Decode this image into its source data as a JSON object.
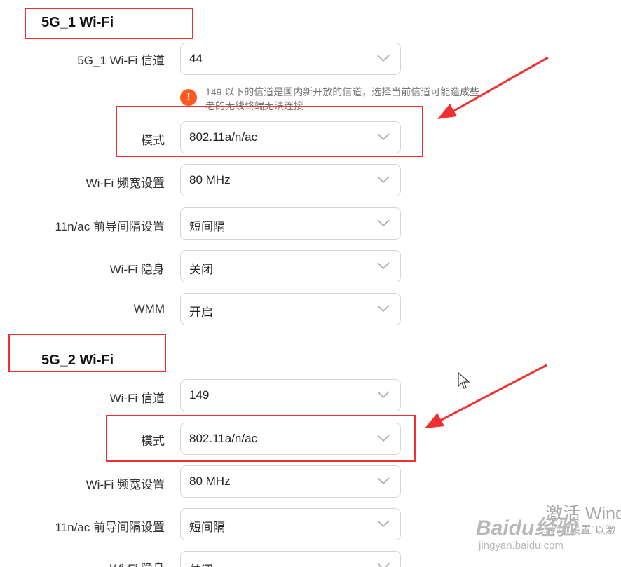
{
  "sections": [
    {
      "title": "5G_1 Wi-Fi",
      "rows": [
        {
          "label": "5G_1 Wi-Fi 信道",
          "value": "44"
        },
        {
          "label": "模式",
          "value": "802.11a/n/ac"
        },
        {
          "label": "Wi-Fi 频宽设置",
          "value": "80 MHz"
        },
        {
          "label": "11n/ac 前导间隔设置",
          "value": "短间隔"
        },
        {
          "label": "Wi-Fi 隐身",
          "value": "关闭"
        },
        {
          "label": "WMM",
          "value": "开启"
        }
      ],
      "warning": {
        "icon": "exclamation-icon",
        "text": "149 以下的信道是国内新开放的信道，选择当前信道可能造成些老的无线终端无法连接"
      }
    },
    {
      "title": "5G_2 Wi-Fi",
      "rows": [
        {
          "label": "Wi-Fi 信道",
          "value": "149"
        },
        {
          "label": "模式",
          "value": "802.11a/n/ac"
        },
        {
          "label": "Wi-Fi 频宽设置",
          "value": "80 MHz"
        },
        {
          "label": "11n/ac 前导间隔设置",
          "value": "短间隔"
        },
        {
          "label": "Wi-Fi 隐身",
          "value": "关闭"
        }
      ]
    }
  ],
  "annotations": {
    "color": "#f03030"
  },
  "watermark": {
    "line1": "激活 Windo",
    "line2": "转到\"设置\"以激",
    "baidu_logo": "Baidu经验",
    "baidu_url": "jingyan.baidu.com"
  }
}
